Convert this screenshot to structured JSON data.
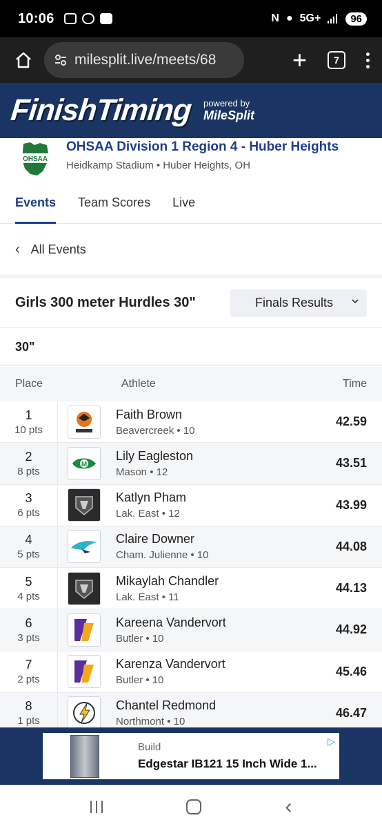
{
  "status_bar": {
    "time": "10:06",
    "network": "5G+",
    "battery": "96"
  },
  "browser": {
    "url": "milesplit.live/meets/68",
    "tab_count": "7"
  },
  "brand": {
    "name": "FinishTiming",
    "powered_label": "powered by",
    "powered_brand": "MileSplit"
  },
  "meet": {
    "logo_text": "OHSAA",
    "title": "OHSAA Division 1 Region 4 - Huber Heights",
    "venue": "Heidkamp Stadium • Huber Heights, OH"
  },
  "tabs": [
    {
      "label": "Events",
      "active": true
    },
    {
      "label": "Team Scores",
      "active": false
    },
    {
      "label": "Live",
      "active": false
    }
  ],
  "nav": {
    "all_events": "All Events"
  },
  "event": {
    "title": "Girls 300 meter Hurdles 30\"",
    "round_selected": "Finals Results",
    "section": "30\""
  },
  "table": {
    "headers": {
      "place": "Place",
      "athlete": "Athlete",
      "time": "Time"
    },
    "rows": [
      {
        "place": "1",
        "pts": "10 pts",
        "name": "Faith Brown",
        "meta": "Beavercreek • 10",
        "time": "42.59",
        "logo": "beavercreek-logo",
        "logo_color": "#e8741c"
      },
      {
        "place": "2",
        "pts": "8 pts",
        "name": "Lily Eagleston",
        "meta": "Mason • 12",
        "time": "43.51",
        "logo": "mason-logo",
        "logo_color": "#1c8a3c"
      },
      {
        "place": "3",
        "pts": "6 pts",
        "name": "Katlyn Pham",
        "meta": "Lak. East • 12",
        "time": "43.99",
        "logo": "lakota-east-logo",
        "logo_color": "#2b2b2b"
      },
      {
        "place": "4",
        "pts": "5 pts",
        "name": "Claire Downer",
        "meta": "Cham. Julienne • 10",
        "time": "44.08",
        "logo": "chaminade-julienne-logo",
        "logo_color": "#2bb3c9"
      },
      {
        "place": "5",
        "pts": "4 pts",
        "name": "Mikaylah Chandler",
        "meta": "Lak. East • 11",
        "time": "44.13",
        "logo": "lakota-east-logo",
        "logo_color": "#2b2b2b"
      },
      {
        "place": "6",
        "pts": "3 pts",
        "name": "Kareena Vandervort",
        "meta": "Butler • 10",
        "time": "44.92",
        "logo": "butler-logo",
        "logo_color": "#5b2d9e"
      },
      {
        "place": "7",
        "pts": "2 pts",
        "name": "Karenza Vandervort",
        "meta": "Butler • 10",
        "time": "45.46",
        "logo": "butler-logo",
        "logo_color": "#5b2d9e"
      },
      {
        "place": "8",
        "pts": "1 pts",
        "name": "Chantel Redmond",
        "meta": "Northmont • 10",
        "time": "46.47",
        "logo": "northmont-logo",
        "logo_color": "#f2c21b"
      }
    ]
  },
  "ad": {
    "source": "Build",
    "title": "Edgestar IB121 15 Inch Wide 1..."
  },
  "colors": {
    "brand_navy": "#1a3563",
    "link_blue": "#1d3e8a"
  }
}
